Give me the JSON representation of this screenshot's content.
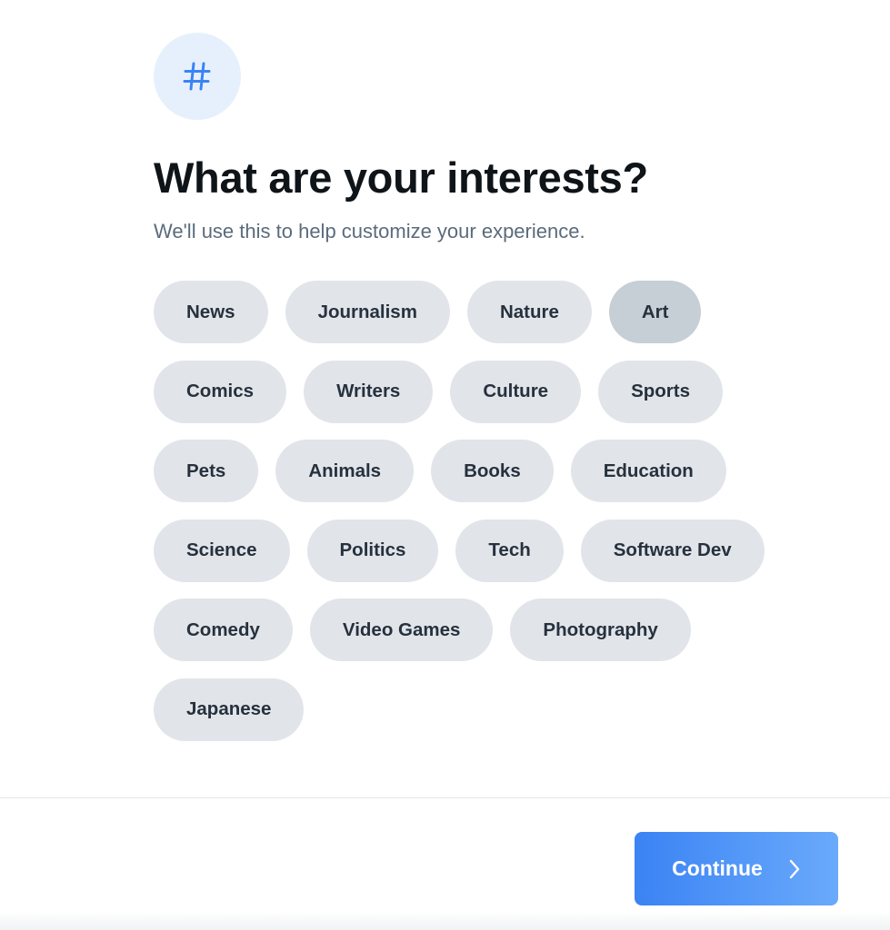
{
  "header": {
    "icon": "hash-icon",
    "title": "What are your interests?",
    "subtitle": "We'll use this to help customize your experience."
  },
  "interests": {
    "rows": [
      [
        {
          "label": "News",
          "selected": false
        },
        {
          "label": "Journalism",
          "selected": false
        },
        {
          "label": "Nature",
          "selected": false
        },
        {
          "label": "Art",
          "selected": true
        }
      ],
      [
        {
          "label": "Comics",
          "selected": false
        },
        {
          "label": "Writers",
          "selected": false
        },
        {
          "label": "Culture",
          "selected": false
        },
        {
          "label": "Sports",
          "selected": false
        }
      ],
      [
        {
          "label": "Pets",
          "selected": false
        },
        {
          "label": "Animals",
          "selected": false
        },
        {
          "label": "Books",
          "selected": false
        },
        {
          "label": "Education",
          "selected": false
        }
      ],
      [
        {
          "label": "Science",
          "selected": false
        },
        {
          "label": "Politics",
          "selected": false
        },
        {
          "label": "Tech",
          "selected": false
        },
        {
          "label": "Software Dev",
          "selected": false
        }
      ],
      [
        {
          "label": "Comedy",
          "selected": false
        },
        {
          "label": "Video Games",
          "selected": false
        },
        {
          "label": "Photography",
          "selected": false
        }
      ],
      [
        {
          "label": "Japanese",
          "selected": false
        }
      ]
    ]
  },
  "footer": {
    "continue_label": "Continue",
    "continue_icon": "chevron-right-icon"
  },
  "colors": {
    "accent": "#3b83f4",
    "chip_bg": "#e1e5ea",
    "chip_selected_bg": "#c6ced6",
    "icon_badge_bg": "#e6f0fd"
  }
}
